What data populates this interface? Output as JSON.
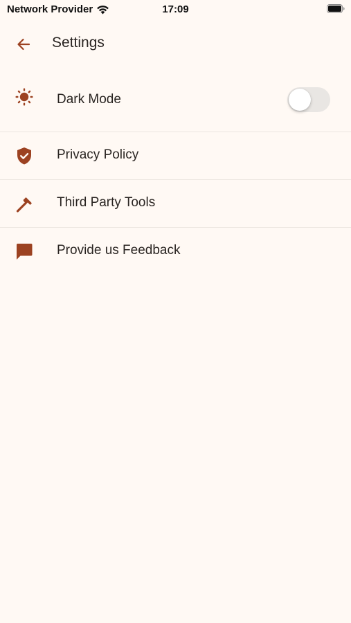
{
  "status_bar": {
    "carrier": "Network Provider",
    "time": "17:09",
    "wifi_icon": "wifi-icon",
    "battery_icon": "battery-icon"
  },
  "app_bar": {
    "title": "Settings",
    "back_icon": "arrow-left-icon"
  },
  "settings": {
    "dark_mode": {
      "label": "Dark Mode",
      "icon": "sun-icon",
      "toggle_on": false
    },
    "privacy_policy": {
      "label": "Privacy Policy",
      "icon": "shield-check-icon"
    },
    "third_party_tools": {
      "label": "Third Party Tools",
      "icon": "hammer-icon"
    },
    "feedback": {
      "label": "Provide us Feedback",
      "icon": "chat-bubble-icon"
    }
  },
  "colors": {
    "background": "#fff9f4",
    "accent": "#9c4221",
    "text": "#2a2522",
    "divider": "#ece6e0",
    "toggle_track_off": "#e9e6e3"
  }
}
